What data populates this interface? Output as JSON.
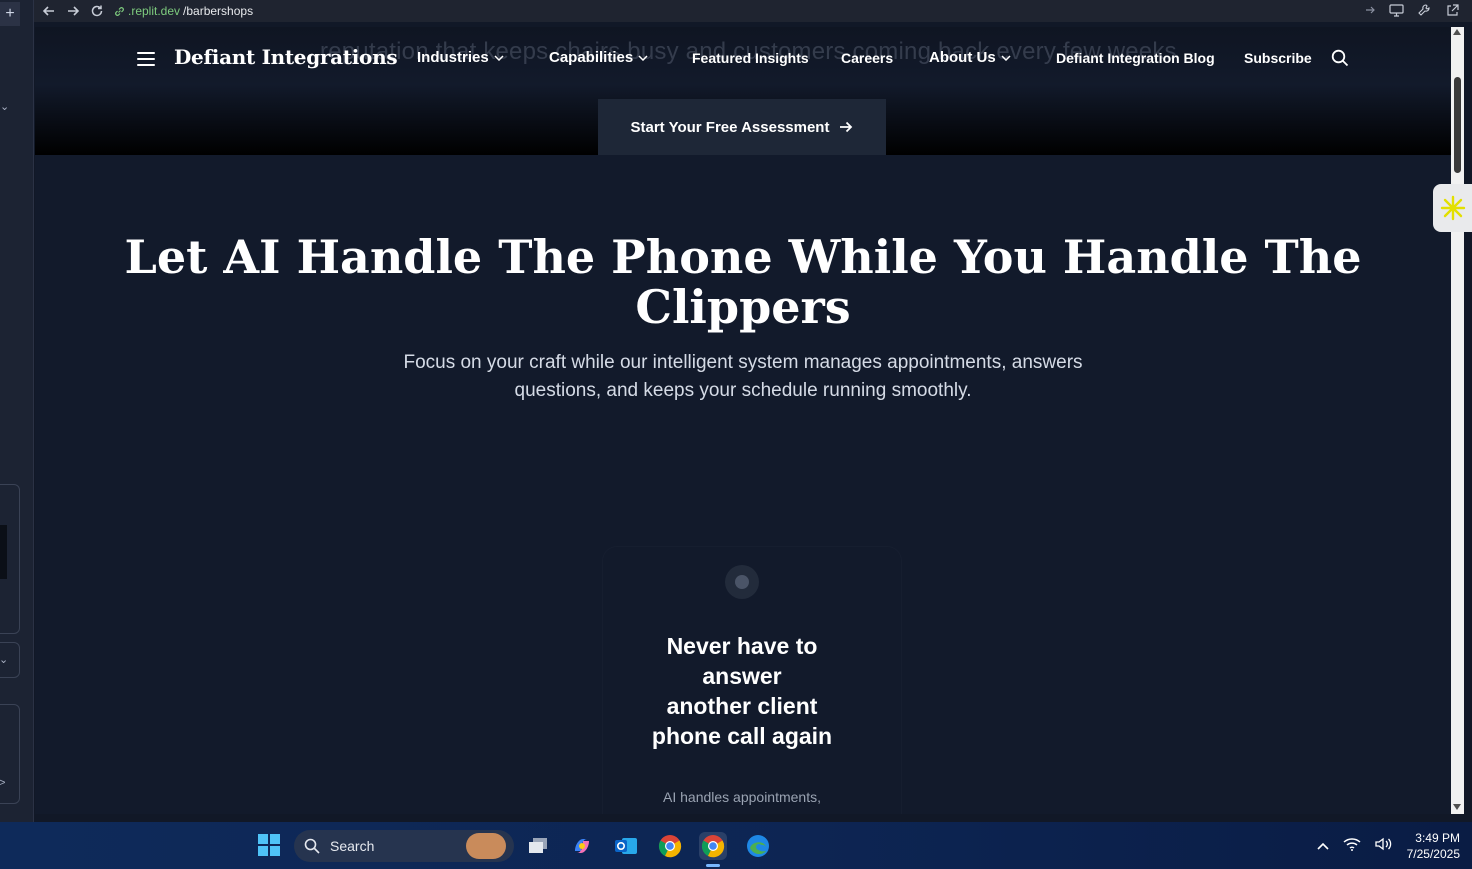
{
  "browser": {
    "url_domain": ".replit.dev",
    "url_path": "/barbershops"
  },
  "header": {
    "ghost_text": "reputation that keeps chairs busy and customers coming back every few weeks",
    "brand": "Defiant Integrations",
    "nav": [
      {
        "label": "Industries",
        "dropdown": true
      },
      {
        "label": "Capabilities",
        "dropdown": true
      },
      {
        "label": "Featured Insights",
        "dropdown": false
      },
      {
        "label": "Careers",
        "dropdown": false
      },
      {
        "label": "About Us",
        "dropdown": true
      },
      {
        "label": "Defiant Integration Blog",
        "dropdown": false
      },
      {
        "label": "Subscribe",
        "dropdown": false
      }
    ],
    "cta_label": "Start Your Free Assessment"
  },
  "hero": {
    "title_line1": "Let AI Handle The Phone While You Handle The",
    "title_line2": "Clippers",
    "subtitle_line1": "Focus on your craft while our intelligent system manages appointments, answers",
    "subtitle_line2": "questions, and keeps your schedule running smoothly."
  },
  "card": {
    "title_lines": [
      "Never have to",
      "answer",
      "another client",
      "phone call again"
    ],
    "description": "AI handles appointments,"
  },
  "taskbar": {
    "search_placeholder": "Search",
    "time": "3:49 PM",
    "date": "7/25/2025"
  },
  "colors": {
    "page_bg": "#121a2b",
    "cta_bg": "#1e2737",
    "taskbar_bg": "#0d2553"
  }
}
